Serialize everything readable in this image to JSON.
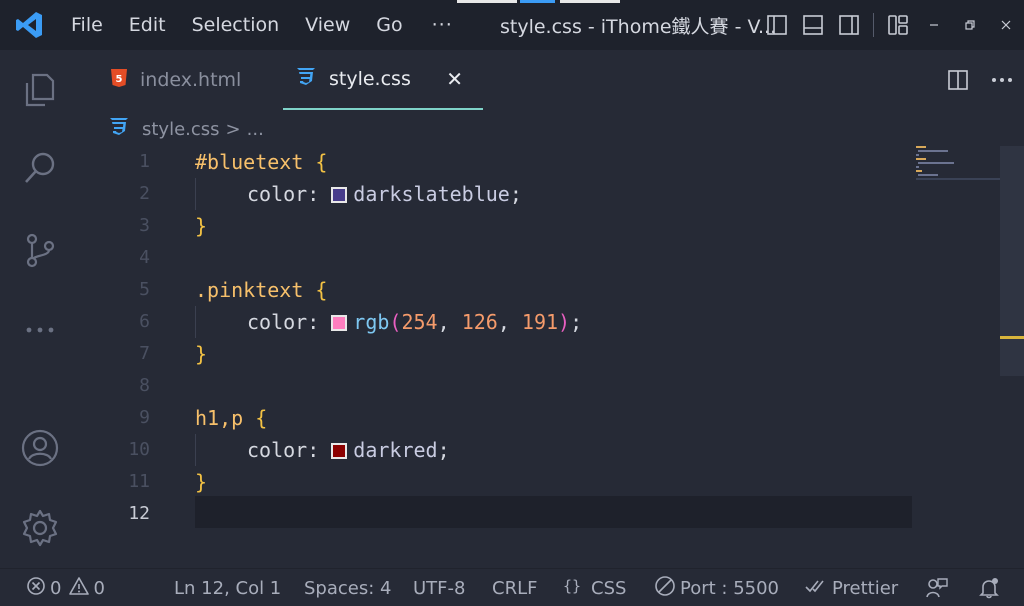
{
  "titlebar": {
    "menu": [
      "File",
      "Edit",
      "Selection",
      "View",
      "Go"
    ],
    "more": "···",
    "title": "style.css - iThome鐵人賽 - V..."
  },
  "tabs": [
    {
      "icon": "html5-icon",
      "label": "index.html",
      "active": false
    },
    {
      "icon": "css3-icon",
      "label": "style.css",
      "active": true,
      "close": "✕"
    }
  ],
  "breadcrumb": {
    "file": "style.css",
    "separator": ">",
    "more": "..."
  },
  "editor": {
    "current_line": 12,
    "line_numbers": [
      "1",
      "2",
      "3",
      "4",
      "5",
      "6",
      "7",
      "8",
      "9",
      "10",
      "11",
      "12"
    ],
    "code": {
      "l1_selector": "#bluetext",
      "l1_brace": "{",
      "l2_prop": "color:",
      "l2_value": "darkslateblue",
      "l2_semi": ";",
      "l3_brace": "}",
      "l5_selector": ".pinktext",
      "l5_brace": "{",
      "l6_prop": "color:",
      "l6_fn": "rgb",
      "l6_open": "(",
      "l6_n1": "254",
      "l6_c1": ", ",
      "l6_n2": "126",
      "l6_c2": ", ",
      "l6_n3": "191",
      "l6_close": ")",
      "l6_semi": ";",
      "l7_brace": "}",
      "l9_selector": "h1,p",
      "l9_brace": "{",
      "l10_prop": "color:",
      "l10_value": "darkred",
      "l10_semi": ";",
      "l11_brace": "}"
    },
    "swatch_colors": {
      "darkslateblue": "#483d8b",
      "pink": "#fe7ebf",
      "darkred": "#8b0000"
    }
  },
  "statusbar": {
    "errors": "0",
    "warnings": "0",
    "position": "Ln 12, Col 1",
    "spaces": "Spaces: 4",
    "encoding": "UTF-8",
    "eol": "CRLF",
    "language": "CSS",
    "port": "Port : 5500",
    "formatter": "Prettier"
  },
  "colors": {
    "accent": "#3b9cf5",
    "tab_underline": "#7fd3c9",
    "html_icon": "#e44d26",
    "css_icon": "#42a5f5"
  }
}
